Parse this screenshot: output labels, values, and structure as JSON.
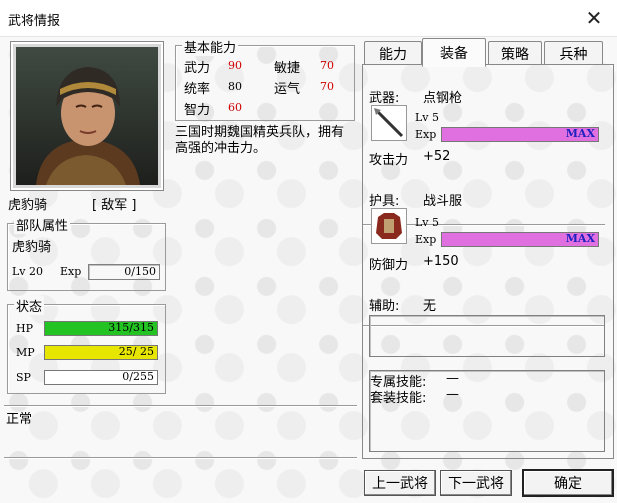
{
  "window": {
    "title": "武将情报",
    "close_glyph": "✕"
  },
  "unit": {
    "name": "虎豹骑",
    "faction": "[ 敌军 ]",
    "portrait_icon": "soldier-portrait"
  },
  "basic_abilities": {
    "title": "基本能力",
    "stats": [
      {
        "label": "武力",
        "value": "90",
        "color": "#d00000"
      },
      {
        "label": "敏捷",
        "value": "70",
        "color": "#d00000"
      },
      {
        "label": "统率",
        "value": "80",
        "color": "#000000"
      },
      {
        "label": "运气",
        "value": "70",
        "color": "#d00000"
      },
      {
        "label": "智力",
        "value": "60",
        "color": "#d00000"
      }
    ],
    "description": "三国时期魏国精英兵队，拥有高强的冲击力。"
  },
  "troop_attributes": {
    "title": "部队属性",
    "type_name": "虎豹骑",
    "level": "Lv 20",
    "exp_label": "Exp",
    "exp_value": "0/150"
  },
  "status": {
    "title": "状态",
    "hp": {
      "label": "HP",
      "text": "315/315",
      "ratio": 1.0,
      "color": "#22c322"
    },
    "mp": {
      "label": "MP",
      "text": "25/ 25",
      "ratio": 1.0,
      "color": "#e6e600"
    },
    "sp": {
      "label": "SP",
      "text": "0/255",
      "ratio": 0.0,
      "color": "#3a8ee6"
    }
  },
  "condition": {
    "text": "正常"
  },
  "tabs": [
    {
      "label": "能力",
      "active": false
    },
    {
      "label": "装备",
      "active": true
    },
    {
      "label": "策略",
      "active": false
    },
    {
      "label": "兵种",
      "active": false
    }
  ],
  "equipment": {
    "weapon": {
      "slot_label": "武器:",
      "name": "点钢枪",
      "level": "Lv 5",
      "exp_label": "Exp",
      "exp_text": "MAX",
      "exp_ratio": 1.0,
      "stat_label": "攻击力",
      "stat_value": "+52",
      "icon": "spear-icon"
    },
    "armor": {
      "slot_label": "护具:",
      "name": "战斗服",
      "level": "Lv 5",
      "exp_label": "Exp",
      "exp_text": "MAX",
      "exp_ratio": 1.0,
      "stat_label": "防御力",
      "stat_value": "+150",
      "icon": "armor-icon"
    },
    "accessory": {
      "slot_label": "辅助:",
      "name": "无"
    },
    "skills": [
      {
        "label": "专属技能:",
        "value": "—"
      },
      {
        "label": "套装技能:",
        "value": "—"
      }
    ]
  },
  "buttons": {
    "prev": "上一武将",
    "next": "下一武将",
    "ok": "确定"
  },
  "colors": {
    "exp_bar": "#e070e0",
    "exp_text": "#2020c0"
  }
}
